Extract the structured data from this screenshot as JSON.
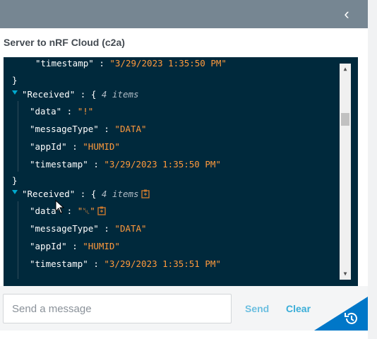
{
  "header": {
    "collapse_icon": "chevron-left-icon"
  },
  "panel": {
    "title": "Server to nRF Cloud (c2a)"
  },
  "console": {
    "lines": [
      {
        "key": "\"timestamp\"",
        "colon": " : ",
        "value": "\"3/29/2023 1:35:50 PM\""
      },
      {
        "brace": "}"
      },
      {
        "key": "\"Received\"",
        "colon": " : { ",
        "meta": "4 items"
      },
      {
        "key": "\"data\"",
        "colon": " : ",
        "value": "\"!\""
      },
      {
        "key": "\"messageType\"",
        "colon": " : ",
        "value": "\"DATA\""
      },
      {
        "key": "\"appId\"",
        "colon": " : ",
        "value": "\"HUMID\""
      },
      {
        "key": "\"timestamp\"",
        "colon": " : ",
        "value": "\"3/29/2023 1:35:50 PM\""
      },
      {
        "brace": "}"
      },
      {
        "key": "\"Received\"",
        "colon": " : { ",
        "meta": "4 items"
      },
      {
        "key": "\"data\"",
        "colon": " : ",
        "value": "\"␀\""
      },
      {
        "key": "\"messageType\"",
        "colon": " : ",
        "value": "\"DATA\""
      },
      {
        "key": "\"appId\"",
        "colon": " : ",
        "value": "\"HUMID\""
      },
      {
        "key": "\"timestamp\"",
        "colon": " : ",
        "value": "\"3/29/2023 1:35:51 PM\""
      }
    ]
  },
  "composer": {
    "placeholder": "Send a message",
    "value": "",
    "send_label": "Send",
    "clear_label": "Clear",
    "history_icon": "history-icon"
  },
  "colors": {
    "header": "#768692",
    "console_bg": "#00293c",
    "string": "#ff9a3c",
    "accent": "#0077c8",
    "link": "#3aaed8"
  }
}
